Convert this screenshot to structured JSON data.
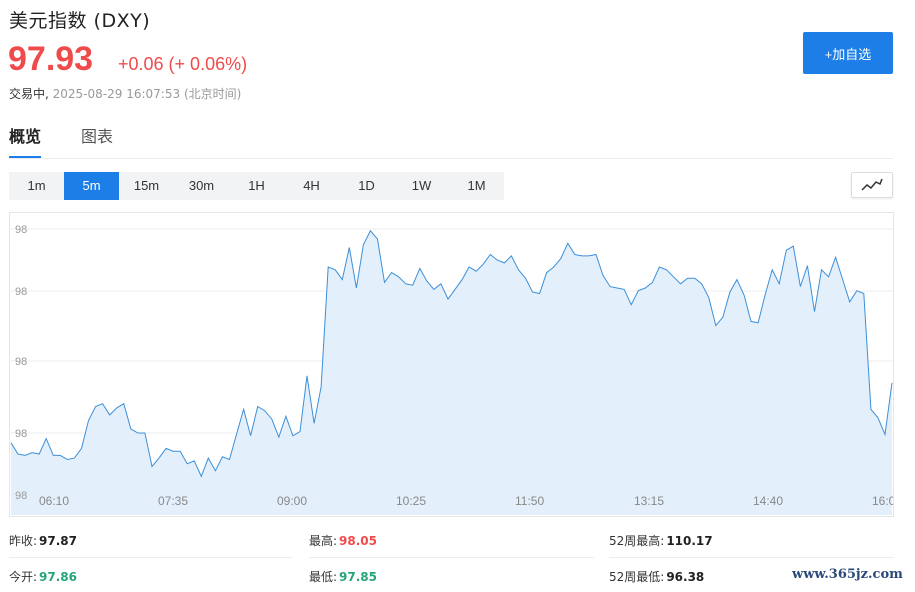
{
  "header": {
    "title": "美元指数 (DXY)",
    "price": "97.93",
    "change": "+0.06 (+ 0.06%)",
    "status": "交易中,",
    "timestamp": "2025-08-29 16:07:53",
    "timezone": "(北京时间)",
    "add_button_label": "+加自选"
  },
  "tabs": [
    {
      "label": "概览",
      "active": true
    },
    {
      "label": "图表",
      "active": false
    }
  ],
  "periods": [
    {
      "label": "1m",
      "active": false
    },
    {
      "label": "5m",
      "active": true
    },
    {
      "label": "15m",
      "active": false
    },
    {
      "label": "30m",
      "active": false
    },
    {
      "label": "1H",
      "active": false
    },
    {
      "label": "4H",
      "active": false
    },
    {
      "label": "1D",
      "active": false
    },
    {
      "label": "1W",
      "active": false
    },
    {
      "label": "1M",
      "active": false
    }
  ],
  "chart_type_icon": "line-chart-icon",
  "chart_data": {
    "type": "area",
    "y_tick_labels": [
      "98",
      "98",
      "98",
      "98",
      "98"
    ],
    "x_tick_labels": [
      "06:10",
      "07:35",
      "09:00",
      "10:25",
      "11:50",
      "13:15",
      "14:40",
      "16:0"
    ],
    "ylim": [
      97.85,
      98.05
    ],
    "values": [
      97.891,
      97.883,
      97.882,
      97.884,
      97.883,
      97.894,
      97.882,
      97.882,
      97.879,
      97.88,
      97.887,
      97.907,
      97.917,
      97.919,
      97.911,
      97.916,
      97.919,
      97.901,
      97.898,
      97.898,
      97.874,
      97.88,
      97.887,
      97.885,
      97.885,
      97.876,
      97.878,
      97.867,
      97.88,
      97.871,
      97.881,
      97.879,
      97.897,
      97.915,
      97.896,
      97.917,
      97.914,
      97.908,
      97.895,
      97.91,
      97.896,
      97.899,
      97.939,
      97.905,
      97.931,
      98.017,
      98.015,
      98.008,
      98.031,
      98.002,
      98.033,
      98.043,
      98.037,
      98.006,
      98.013,
      98.01,
      98.005,
      98.004,
      98.016,
      98.007,
      98.001,
      98.005,
      97.994,
      98.001,
      98.008,
      98.017,
      98.014,
      98.019,
      98.026,
      98.022,
      98.02,
      98.025,
      98.015,
      98.009,
      97.999,
      97.998,
      98.013,
      98.017,
      98.023,
      98.034,
      98.026,
      98.025,
      98.025,
      98.026,
      98.011,
      98.003,
      98.002,
      98.001,
      97.99,
      98.0,
      98.002,
      98.006,
      98.017,
      98.015,
      98.01,
      98.005,
      98.009,
      98.009,
      98.005,
      97.995,
      97.975,
      97.981,
      97.999,
      98.008,
      97.997,
      97.978,
      97.977,
      97.997,
      98.015,
      98.005,
      98.029,
      98.032,
      98.003,
      98.018,
      97.985,
      98.015,
      98.01,
      98.024,
      98.008,
      97.992,
      98.0,
      97.998,
      97.915,
      97.909,
      97.897,
      97.934
    ]
  },
  "stats": {
    "prev_close_label": "昨收:",
    "prev_close": "97.87",
    "open_label": "今开:",
    "open": "97.86",
    "high_label": "最高:",
    "high": "98.05",
    "low_label": "最低:",
    "low": "97.85",
    "week52_high_label": "52周最高:",
    "week52_high": "110.17",
    "week52_low_label": "52周最低:",
    "week52_low": "96.38"
  },
  "colors": {
    "up": "#f04b4b",
    "down": "#27a57a",
    "accent": "#1c7ee6",
    "line": "#3d8fd8",
    "area": "#e3f0fc"
  },
  "watermark": "www.365jz.com"
}
